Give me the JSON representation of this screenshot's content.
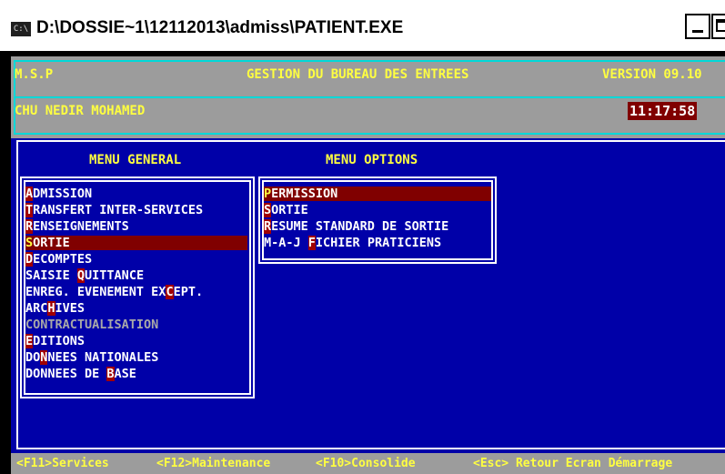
{
  "window": {
    "icon_label": "C:\\",
    "title": "D:\\DOSSIE~1\\12112013\\admiss\\PATIENT.EXE"
  },
  "header": {
    "left": "M.S.P",
    "center": "GESTION DU BUREAU DES ENTREES",
    "version": "VERSION  09.10",
    "hospital": "CHU NEDIR MOHAMED",
    "time": "11:17:58"
  },
  "menu_general": {
    "title": "MENU GENERAL",
    "items": [
      {
        "label": "ADMISSION",
        "hotkey_index": 0
      },
      {
        "label": "TRANSFERT INTER-SERVICES",
        "hotkey_index": 0
      },
      {
        "label": "RENSEIGNEMENTS",
        "hotkey_index": 0
      },
      {
        "label": "SORTIE",
        "hotkey_index": 0,
        "selected": true
      },
      {
        "label": "DECOMPTES",
        "hotkey_index": 0
      },
      {
        "label": "SAISIE QUITTANCE",
        "hotkey_index": 7
      },
      {
        "label": "ENREG. EVENEMENT EXCEPT.",
        "hotkey_index": 19
      },
      {
        "label": "ARCHIVES",
        "hotkey_index": 3
      },
      {
        "label": "CONTRACTUALISATION",
        "hotkey_index": -1,
        "disabled": true
      },
      {
        "label": "EDITIONS",
        "hotkey_index": 0
      },
      {
        "label": "DONNEES NATIONALES",
        "hotkey_index": 2
      },
      {
        "label": "DONNEES DE BASE",
        "hotkey_index": 11
      }
    ]
  },
  "menu_options": {
    "title": "MENU OPTIONS",
    "items": [
      {
        "label": "PERMISSION",
        "hotkey_index": 0,
        "selected": true
      },
      {
        "label": "SORTIE",
        "hotkey_index": 0
      },
      {
        "label": "RESUME STANDARD DE SORTIE",
        "hotkey_index": 0
      },
      {
        "label": "M-A-J FICHIER PRATICIENS",
        "hotkey_index": 6
      }
    ]
  },
  "footer": {
    "f11": "<F11>Services",
    "f12": "<F12>Maintenance",
    "f10": "<F10>Consolide",
    "esc": "<Esc> Retour Ecran Démarrage"
  },
  "colors": {
    "console_blue": "#0000a8",
    "header_gray": "#9c9c9c",
    "highlight": "#800000",
    "frame_cyan": "#00d8d8",
    "text_yellow": "#ffff40"
  }
}
